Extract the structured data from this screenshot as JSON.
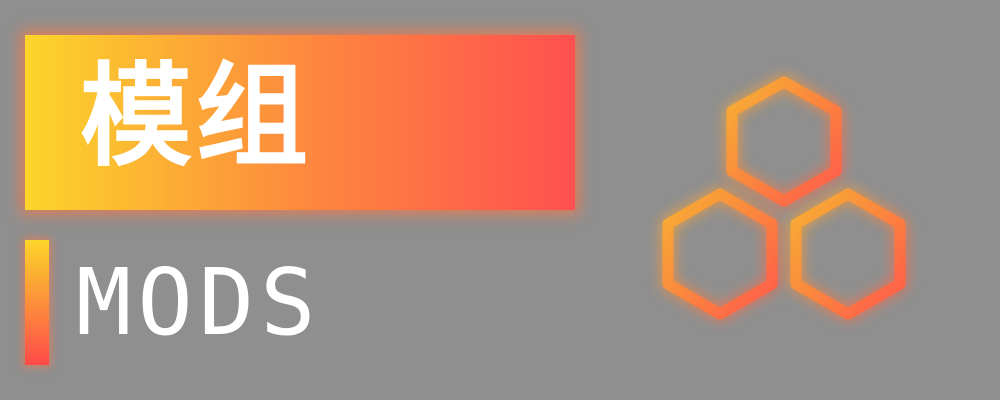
{
  "banner": {
    "title": "模组"
  },
  "section": {
    "subtitle": "MODS"
  },
  "logo": {
    "icon": "hexagon-cluster-icon"
  },
  "colors": {
    "background": "#8f8f8f",
    "gradient_start": "#fbd52a",
    "gradient_mid": "#fd8a3e",
    "gradient_end": "#ff5050",
    "text": "#ffffff"
  }
}
